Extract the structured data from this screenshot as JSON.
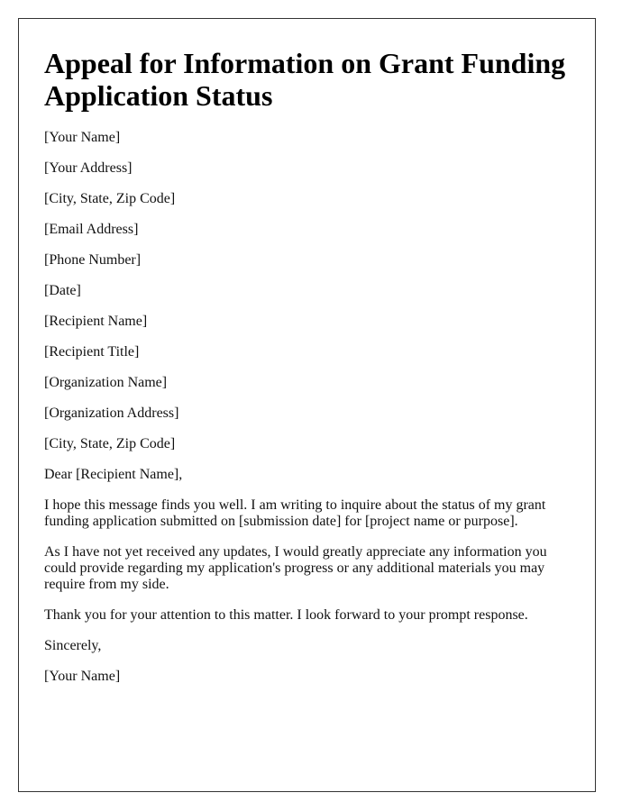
{
  "document": {
    "title": "Appeal for Information on Grant Funding Application Status",
    "sender": {
      "name": "[Your Name]",
      "address": "[Your Address]",
      "city_state_zip": "[City, State, Zip Code]",
      "email": "[Email Address]",
      "phone": "[Phone Number]"
    },
    "date": "[Date]",
    "recipient": {
      "name": "[Recipient Name]",
      "title": "[Recipient Title]",
      "organization": "[Organization Name]",
      "organization_address": "[Organization Address]",
      "city_state_zip": "[City, State, Zip Code]"
    },
    "salutation": "Dear [Recipient Name],",
    "body": [
      "I hope this message finds you well. I am writing to inquire about the status of my grant funding application submitted on [submission date] for [project name or purpose].",
      "As I have not yet received any updates, I would greatly appreciate any information you could provide regarding my application's progress or any additional materials you may require from my side.",
      "Thank you for your attention to this matter. I look forward to your prompt response."
    ],
    "closing": "Sincerely,",
    "signature": "[Your Name]"
  }
}
